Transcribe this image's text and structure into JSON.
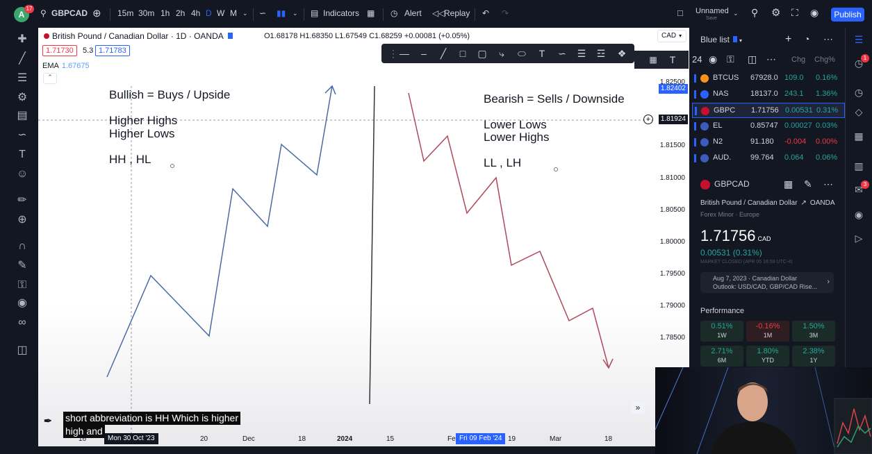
{
  "app": {
    "avatar_letter": "A",
    "notifications": "17",
    "symbol": "GBPCAD",
    "intervals": [
      "15m",
      "30m",
      "1h",
      "2h",
      "4h",
      "D",
      "W",
      "M"
    ],
    "active_interval": "D",
    "indicators_label": "Indicators",
    "alert_label": "Alert",
    "replay_label": "Replay",
    "layout_name": "Unnamed",
    "layout_sub": "Save",
    "publish_label": "Publish"
  },
  "chart": {
    "title": "British Pound / Canadian Dollar · 1D · OANDA",
    "ohlc": "O1.68178 H1.68350 L1.67549 C1.68259 +0.00081 (+0.05%)",
    "sell_price": "1.71730",
    "spread": "5.3",
    "buy_price": "1.71783",
    "ema_label": "EMA",
    "ema_value": "1.67675",
    "currency": "CAD",
    "notes_left": [
      "Bullish = Buys / Upside",
      "Higher Highs",
      "Higher Lows",
      "HH , HL"
    ],
    "notes_right": [
      "Bearish = Sells / Downside",
      "Lower Lows",
      "Lower Highs",
      "LL , LH"
    ],
    "y_ticks": [
      "1.82500",
      "1.81500",
      "1.81000",
      "1.80500",
      "1.80000",
      "1.79500",
      "1.79000",
      "1.78500"
    ],
    "y_badge_blue": "1.82402",
    "y_badge_cross": "1.81924",
    "x_ticks": [
      "16",
      "20",
      "Dec",
      "18",
      "2024",
      "15",
      "Feb",
      "19",
      "Mar",
      "18"
    ],
    "x_badge_left": "Mon 30 Oct '23",
    "x_badge_right": "Fri 09 Feb '24",
    "colors": {
      "bull": "#4a6aa5",
      "bear": "#b0475a",
      "accent": "#2962ff"
    }
  },
  "subtitle": {
    "line1": "short abbreviation is HH Which is higher",
    "line2": "high and"
  },
  "watchlist": {
    "title": "Blue list",
    "columns": [
      "Chg",
      "Chg%"
    ],
    "rows": [
      {
        "sym": "BTCUS",
        "last": "67928.0",
        "chg": "109.0",
        "pct": "0.16%",
        "dir": "up",
        "color": "#f7931a"
      },
      {
        "sym": "NAS",
        "last": "18137.0",
        "chg": "243.1",
        "pct": "1.36%",
        "dir": "up",
        "color": "#2962ff"
      },
      {
        "sym": "GBPC",
        "last": "1.71756",
        "chg": "0.00531",
        "pct": "0.31%",
        "dir": "up",
        "color": "#c8102e",
        "selected": true
      },
      {
        "sym": "EL",
        "last": "0.85747",
        "chg": "0.00027",
        "pct": "0.03%",
        "dir": "up",
        "color": "#3c5bbd"
      },
      {
        "sym": "N2",
        "last": "91.180",
        "chg": "-0.004",
        "pct": "0.00%",
        "dir": "down",
        "color": "#3c5bbd"
      },
      {
        "sym": "AUD.",
        "last": "99.764",
        "chg": "0.064",
        "pct": "0.06%",
        "dir": "up",
        "color": "#3c5bbd"
      }
    ]
  },
  "details": {
    "symbol": "GBPCAD",
    "name": "British Pound / Canadian Dollar",
    "exchange": "OANDA",
    "category": "Forex Minor · Europe",
    "price": "1.71756",
    "currency": "CAD",
    "change": "0.00531 (0.31%)",
    "status": "MARKET CLOSED",
    "status_time": "(APR 05 16:59 UTC-4)",
    "news_date": "Aug 7, 2023 · Canadian Dollar",
    "news_title": "Outlook: USD/CAD, GBP/CAD Rise...",
    "performance_label": "Performance",
    "performance": [
      {
        "value": "0.51%",
        "label": "1W",
        "dir": "up"
      },
      {
        "value": "-0.16%",
        "label": "1M",
        "dir": "down"
      },
      {
        "value": "1.50%",
        "label": "3M",
        "dir": "up"
      },
      {
        "value": "2.71%",
        "label": "6M",
        "dir": "up"
      },
      {
        "value": "1.80%",
        "label": "YTD",
        "dir": "up"
      },
      {
        "value": "2.38%",
        "label": "1Y",
        "dir": "up"
      }
    ]
  }
}
